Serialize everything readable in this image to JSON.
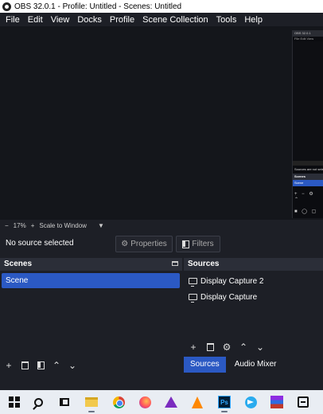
{
  "window": {
    "title": "OBS 32.0.1 - Profile: Untitled - Scenes: Untitled"
  },
  "menu": [
    "File",
    "Edit",
    "View",
    "Docks",
    "Profile",
    "Scene Collection",
    "Tools",
    "Help"
  ],
  "preview_thumb": {
    "title": "OBS 32.0.1",
    "menu": "File  Edit  View",
    "status": "Sources are not selected",
    "scenes_header": "Scenes",
    "scene": "Scene"
  },
  "zoom": {
    "minus": "−",
    "value": "17%",
    "plus": "+",
    "mode": "Scale to Window",
    "dropdown": "▼"
  },
  "context": {
    "no_source": "No source selected",
    "properties": "Properties",
    "filters": "Filters"
  },
  "scenes": {
    "header": "Scenes",
    "items": [
      "Scene"
    ]
  },
  "sources": {
    "header": "Sources",
    "items": [
      "Display Capture 2",
      "Display Capture"
    ]
  },
  "tabs": {
    "sources": "Sources",
    "audio_mixer": "Audio Mixer"
  },
  "toolbar_glyphs": {
    "add": "+",
    "gear": "⚙",
    "up": "⌃",
    "down": "⌄"
  },
  "taskbar": {
    "icons": [
      "windows-start-icon",
      "search-icon",
      "task-view-icon",
      "file-explorer-icon",
      "chrome-icon",
      "firefox-icon",
      "affinity-icon",
      "vlc-icon",
      "photoshop-icon",
      "telegram-icon",
      "winrar-icon",
      "capcut-icon"
    ],
    "photoshop_label": "Ps"
  },
  "colors": {
    "accent": "#2b59c3",
    "panel": "#1d1f26",
    "dock_header": "#2b2e38",
    "preview": "#14161b",
    "taskbar": "#e9edf3"
  }
}
